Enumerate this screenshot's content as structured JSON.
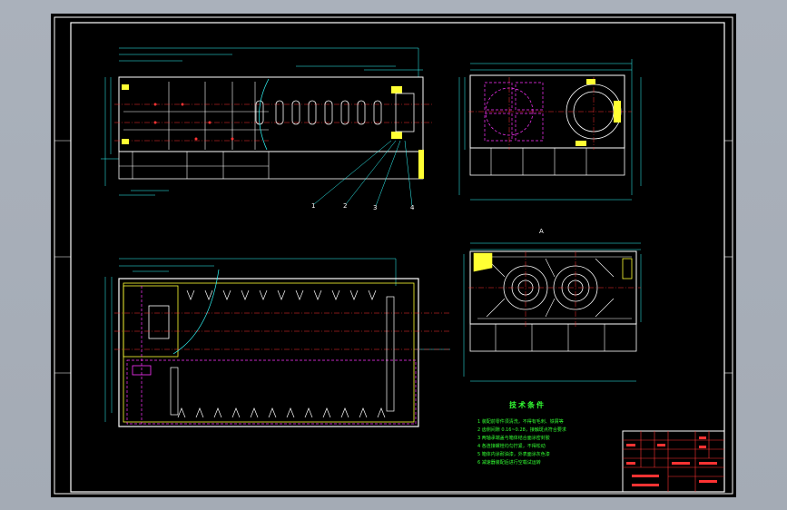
{
  "viewport": {
    "background": "#a9b0ba",
    "sheet_color": "#000000"
  },
  "colors": {
    "frame": "#ffffff",
    "outline": "#ffff33",
    "dimension": "#33ffff",
    "center_line": "#ff3333",
    "hidden": "#ff33ff",
    "text": "#33ff33"
  },
  "views": {
    "front_view": "front-elevation",
    "side_view": "side-elevation",
    "top_view": "plan-view",
    "end_view": "end-elevation"
  },
  "leader_labels": [
    "1",
    "2",
    "3",
    "4"
  ],
  "section_marks": {
    "end_view_mark": "A"
  },
  "notes": {
    "title": "技术条件",
    "lines": [
      "1 装配前零件须清洗，不得有毛刺、铁屑等",
      "2 齿侧间隙 0.16~0.28，接触斑点符合要求",
      "3 两轴承端盖与箱体结合面涂密封胶",
      "4 各连接螺栓均匀拧紧，不得松动",
      "5 箱体内涂耐油漆，外表面涂灰色漆",
      "6 减速器装配后进行空载试运转"
    ]
  }
}
